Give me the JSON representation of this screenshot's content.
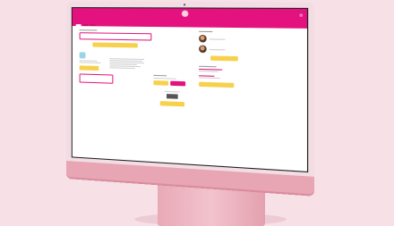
{
  "scene": {
    "background": "#f7e1e7",
    "device": "desktop-monitor",
    "accent": "#e3127f",
    "button_color": "#f7d14c"
  },
  "screen": {
    "brand": "",
    "page_title": "",
    "tabs": [
      "",
      "",
      ""
    ],
    "footer_left": "",
    "footer_right": ""
  }
}
